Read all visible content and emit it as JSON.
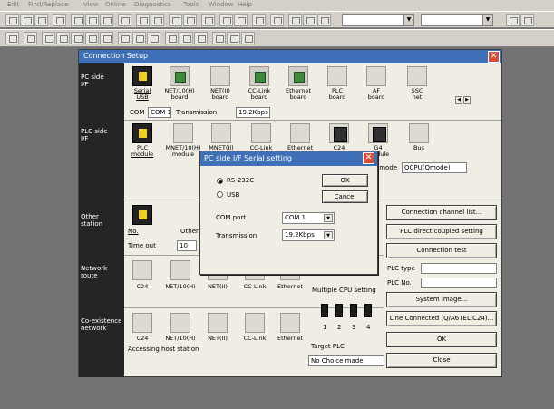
{
  "menubar": {
    "items": [
      "Edit",
      "Find/Replace",
      "View",
      "Online",
      "Diagnostics",
      "Tools",
      "Window",
      "Help"
    ]
  },
  "toolbar": {
    "icons": [
      "new-icon",
      "open-icon",
      "save-icon",
      "print-icon",
      "cut-icon",
      "copy-icon",
      "paste-icon",
      "undo-icon",
      "find-icon",
      "zoom-icon"
    ],
    "combo1_value": "",
    "combo2_value": ""
  },
  "dialog": {
    "title": "Connection Setup",
    "close_glyph": "✕",
    "sections": {
      "pc_side": "PC side\nI/F",
      "plc_side": "PLC side\nI/F",
      "other_station": "Other\nstation",
      "network_route": "Network\nroute",
      "coexistence_network": "Co-existence\nnetwork"
    },
    "pc_side_items": [
      {
        "icon": "serial-usb-icon",
        "label": "Serial\nUSB"
      },
      {
        "icon": "net10h-board-icon",
        "label": "NET/10(H)\nboard"
      },
      {
        "icon": "netii-board-icon",
        "label": "NET(II)\nboard"
      },
      {
        "icon": "cc-link-board-icon",
        "label": "CC-Link\nboard"
      },
      {
        "icon": "ethernet-board-icon",
        "label": "Ethernet\nboard"
      },
      {
        "icon": "plc-board-icon",
        "label": "PLC\nboard"
      },
      {
        "icon": "af-board-icon",
        "label": "AF\nboard"
      },
      {
        "icon": "ssc-net-icon",
        "label": "SSC\nnet"
      }
    ],
    "com_label": "COM",
    "com_value": "COM 1",
    "transmission_label": "Transmission",
    "transmission_value": "19.2Kbps",
    "plc_side_items": [
      {
        "icon": "plc-module-icon",
        "label": "PLC\nmodule"
      },
      {
        "icon": "mnet10h-module-icon",
        "label": "MNET/10(H)\nmodule"
      },
      {
        "icon": "mnetii-module-icon",
        "label": "MNET(II)\nmodule"
      },
      {
        "icon": "cc-link-module-icon",
        "label": "CC-Link\nmodule"
      },
      {
        "icon": "ethernet-module-icon",
        "label": "Ethernet\nmodule"
      },
      {
        "icon": "c24-module-icon",
        "label": "C24"
      },
      {
        "icon": "g4-module-icon",
        "label": "G4\nmodule"
      },
      {
        "icon": "bus-module-icon",
        "label": "Bus"
      }
    ],
    "plc_mode_label": "PLC mode",
    "plc_mode_value": "QCPU(Qmode)",
    "other_station_no": "No.",
    "other_station_other": "Other",
    "timeout_label": "Time out",
    "timeout_value": "10",
    "network_items": [
      "C24",
      "NET/10(H)",
      "NET(II)",
      "CC-Link",
      "Ethernet"
    ],
    "coexistence_items": [
      "C24",
      "NET/10(H)",
      "NET(II)",
      "CC-Link",
      "Ethernet"
    ],
    "accessing_host": "Accessing host station",
    "multiple_cpu_label": "Multiple CPU setting",
    "cpu_numbers": [
      "1",
      "2",
      "3",
      "4"
    ],
    "target_plc_label": "Target PLC",
    "target_plc_value": "No Choice made",
    "buttons": {
      "connection_channel_list": "Connection channel list...",
      "plc_direct_coupled": "PLC direct coupled setting",
      "connection_test": "Connection test",
      "system_image": "System image...",
      "line_connected": "Line Connected (Q/A6TEL,C24)...",
      "ok": "OK",
      "close": "Close"
    },
    "plc_type_label": "PLC type",
    "plc_no_label": "PLC No."
  },
  "serial_dialog": {
    "title": "PC side I/F  Serial setting",
    "close_glyph": "✕",
    "radio_rs232c": "RS-232C",
    "radio_usb": "USB",
    "rs232c_selected": true,
    "ok_label": "OK",
    "cancel_label": "Cancel",
    "com_port_label": "COM port",
    "com_port_value": "COM 1",
    "transmission_label": "Transmission",
    "transmission_value": "19.2Kbps"
  },
  "colors": {
    "titlebar": "#3e6fb7",
    "dialog_bg": "#efede4",
    "sidebar": "#252525",
    "workspace": "#737373"
  }
}
